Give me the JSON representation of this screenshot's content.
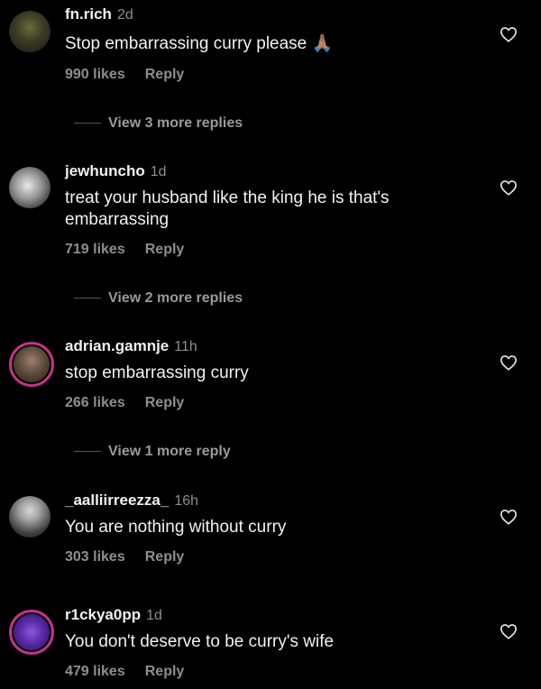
{
  "comments": [
    {
      "username": "fn.rich",
      "time": "2d",
      "text": "Stop embarrassing curry please 🙏🏽",
      "likes": "990 likes",
      "reply": "Reply",
      "view_more": "View 3 more replies"
    },
    {
      "username": "jewhuncho",
      "time": "1d",
      "text": "treat your husband like the king he is that's embarrassing",
      "likes": "719 likes",
      "reply": "Reply",
      "view_more": "View 2 more replies"
    },
    {
      "username": "adrian.gamnje",
      "time": "11h",
      "text": "stop embarrassing curry",
      "likes": "266 likes",
      "reply": "Reply",
      "view_more": "View 1 more reply"
    },
    {
      "username": "_aalliirreezza_",
      "time": "16h",
      "text": "You are nothing without curry",
      "likes": "303 likes",
      "reply": "Reply"
    },
    {
      "username": "r1ckya0pp",
      "time": "1d",
      "text": "You don't deserve to be curry's wife",
      "likes": "479 likes",
      "reply": "Reply"
    }
  ],
  "colors": {
    "background": "#000000",
    "muted": "#8e8e8e",
    "story_ring": "#c13584"
  },
  "icons": {
    "like": "heart-outline-icon"
  }
}
